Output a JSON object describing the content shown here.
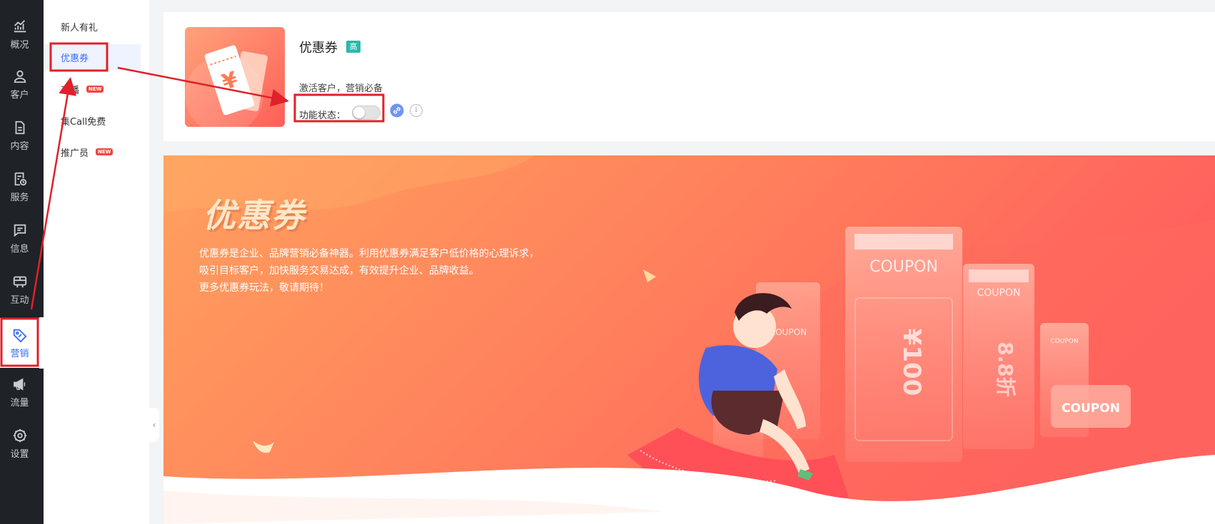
{
  "rail": {
    "items": [
      {
        "label": "概况",
        "icon": "chart-icon"
      },
      {
        "label": "客户",
        "icon": "user-icon"
      },
      {
        "label": "内容",
        "icon": "document-icon"
      },
      {
        "label": "服务",
        "icon": "service-icon"
      },
      {
        "label": "信息",
        "icon": "message-icon"
      },
      {
        "label": "互动",
        "icon": "interact-icon"
      },
      {
        "label": "营销",
        "icon": "tag-icon",
        "active": true
      },
      {
        "label": "流量",
        "icon": "megaphone-icon"
      },
      {
        "label": "设置",
        "icon": "gear-icon"
      }
    ]
  },
  "subnav": {
    "items": [
      {
        "label": "新人有礼"
      },
      {
        "label": "优惠券",
        "active": true
      },
      {
        "label": "直播",
        "badge": "NEW"
      },
      {
        "label": "集Call免费"
      },
      {
        "label": "推广员",
        "badge": "NEW"
      }
    ]
  },
  "card": {
    "title": "优惠券",
    "tag": "高",
    "description": "激活客户，营销必备",
    "status_label": "功能状态：",
    "status_on": false
  },
  "banner": {
    "title": "优惠券",
    "lines": [
      "优惠券是企业、品牌营销必备神器。利用优惠券满足客户低价格的心理诉求，",
      "吸引目标客户，加快服务交易达成，有效提升企业、品牌收益。",
      "更多优惠券玩法，敬请期待！"
    ],
    "coupon_text": "COUPON",
    "ticket_values": [
      "¥100",
      "8.8折"
    ]
  },
  "colors": {
    "accent": "#3a6cf6",
    "annotation": "#e0202a",
    "banner_start": "#ffa05e",
    "banner_end": "#ff5d5d",
    "rail_bg": "#1f2227"
  }
}
